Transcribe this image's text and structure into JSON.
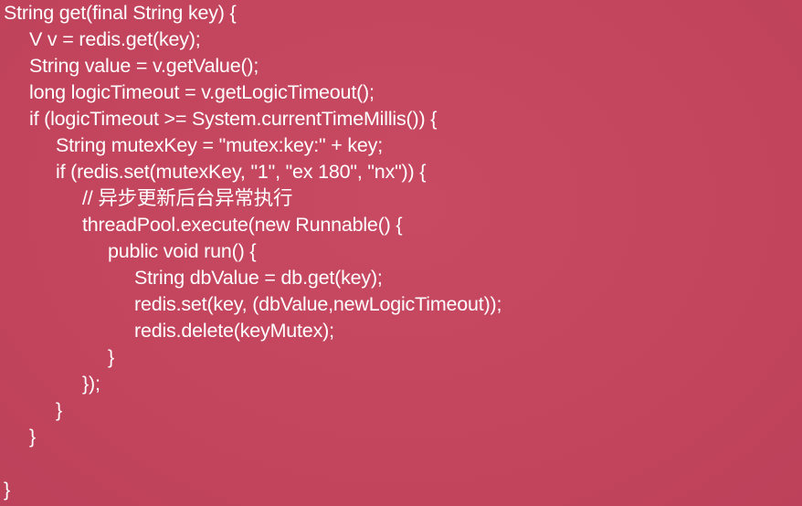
{
  "code": {
    "lines": [
      "String get(final String key) {",
      "V v = redis.get(key);",
      "String value = v.getValue();",
      "long logicTimeout = v.getLogicTimeout();",
      "if (logicTimeout >= System.currentTimeMillis()) {",
      "String mutexKey = \"mutex:key:\" + key;",
      "if (redis.set(mutexKey, \"1\", \"ex 180\", \"nx\")) {",
      "// 异步更新后台异常执行",
      "threadPool.execute(new Runnable() {",
      "public void run() {",
      "String dbValue = db.get(key);",
      "redis.set(key, (dbValue,newLogicTimeout));",
      "redis.delete(keyMutex);",
      "}",
      "});",
      "}",
      "}",
      "}"
    ]
  },
  "colors": {
    "background": "#c4475f",
    "text": "#ffffff"
  }
}
